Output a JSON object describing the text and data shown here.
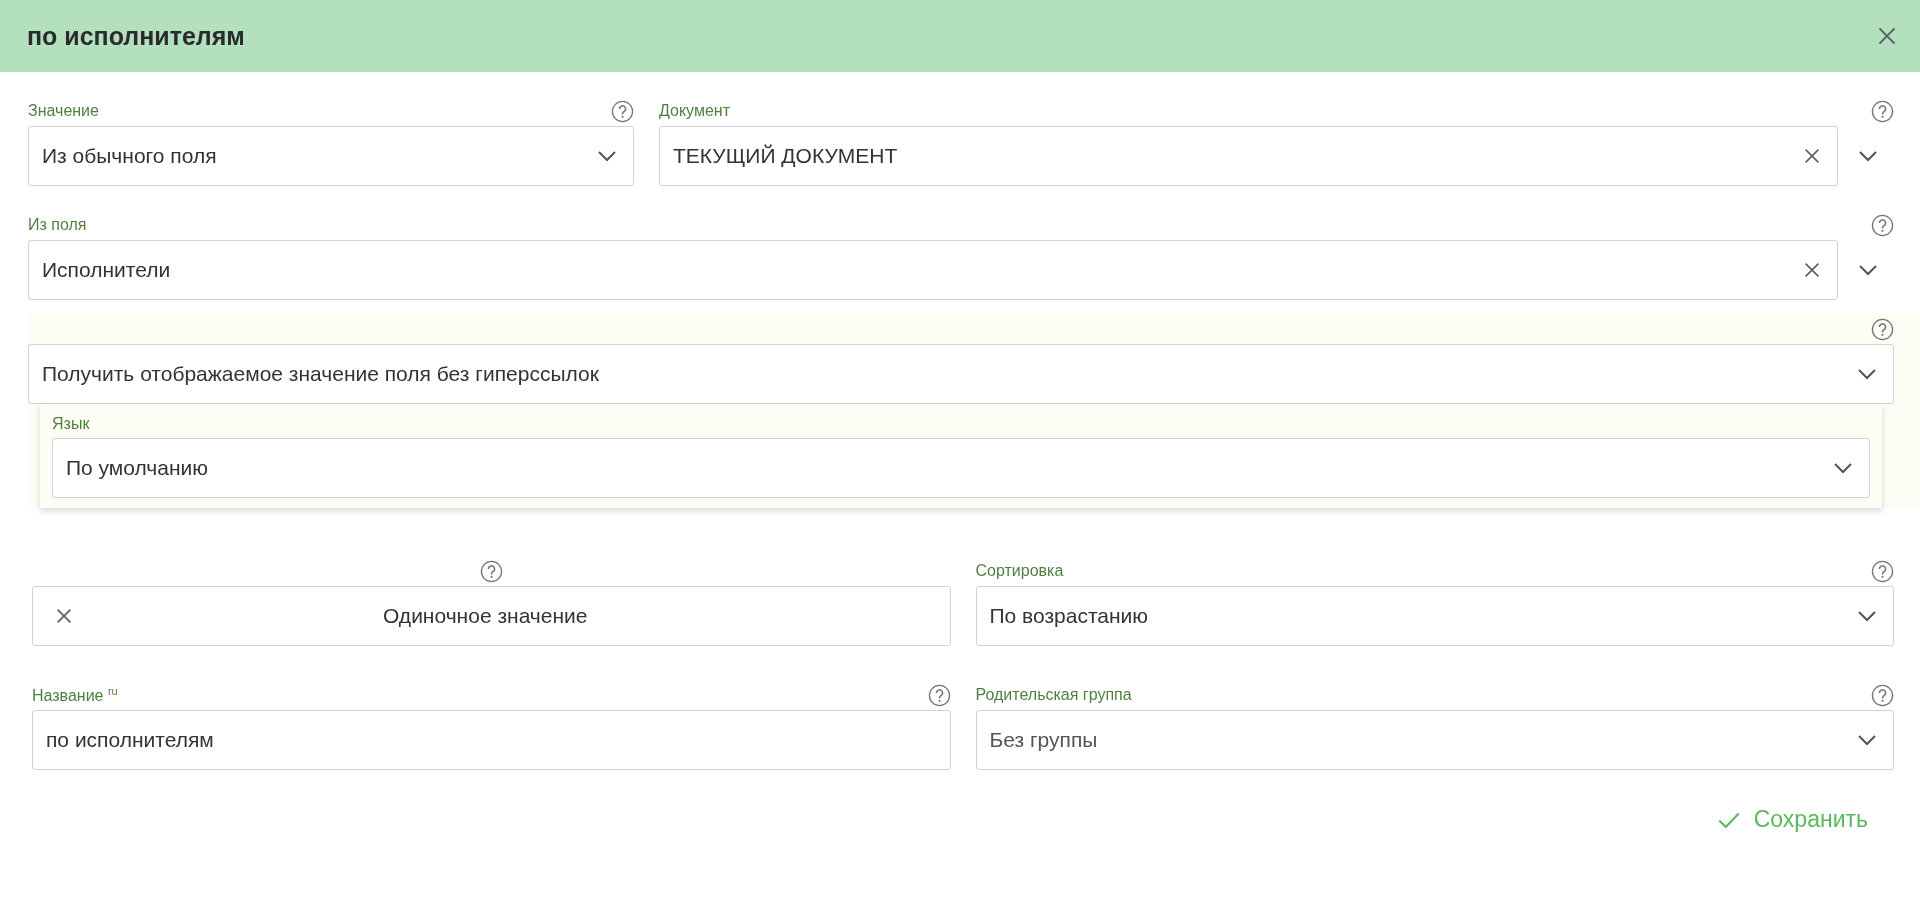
{
  "dialog": {
    "title": "по исполнителям"
  },
  "value_source": {
    "label": "Значение",
    "value": "Из обычного поля"
  },
  "document": {
    "label": "Документ",
    "value": "ТЕКУЩИЙ ДОКУМЕНТ"
  },
  "source_field": {
    "label": "Из поля",
    "value": "Исполнители"
  },
  "mode": {
    "value": "Получить отображаемое значение поля без гиперссылок"
  },
  "language": {
    "label": "Язык",
    "value": "По умолчанию"
  },
  "multiplicity": {
    "value": "Одиночное значение"
  },
  "sorting": {
    "label": "Сортировка",
    "value": "По возрастанию"
  },
  "name": {
    "label": "Название $^{ru}$",
    "value": "по исполнителям"
  },
  "parent_group": {
    "label": "Родительская группа",
    "value": "Без группы"
  },
  "save_button": {
    "label": "Сохранить"
  }
}
